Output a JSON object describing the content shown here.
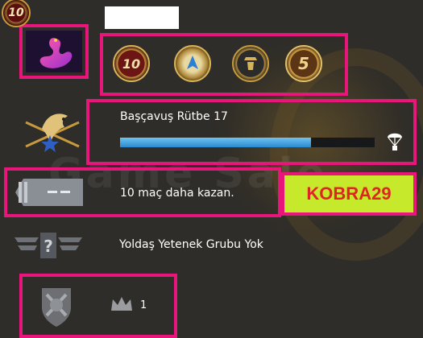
{
  "profile": {
    "level_badge": "10",
    "name_placeholder": ""
  },
  "coins": [
    {
      "icon": "level-10-coin-icon",
      "label": "10",
      "color": "#7a1a1a"
    },
    {
      "icon": "blue-service-coin-icon",
      "label": "",
      "color": "#c9a55a"
    },
    {
      "icon": "soldier-emblem-coin-icon",
      "label": "",
      "color": "#2a2a2a"
    },
    {
      "icon": "level-5-coin-icon",
      "label": "5",
      "color": "#6a3d1a"
    }
  ],
  "rank": {
    "title": "Başçavuş Rütbe 17",
    "progress_percent": 75
  },
  "wins": {
    "message": "10 maç daha kazan."
  },
  "promo": {
    "code": "KOBRA29"
  },
  "skill": {
    "message": "Yoldaş Yetenek Grubu Yok"
  },
  "medals": {
    "count": "1"
  },
  "watermark": "Game Sale"
}
